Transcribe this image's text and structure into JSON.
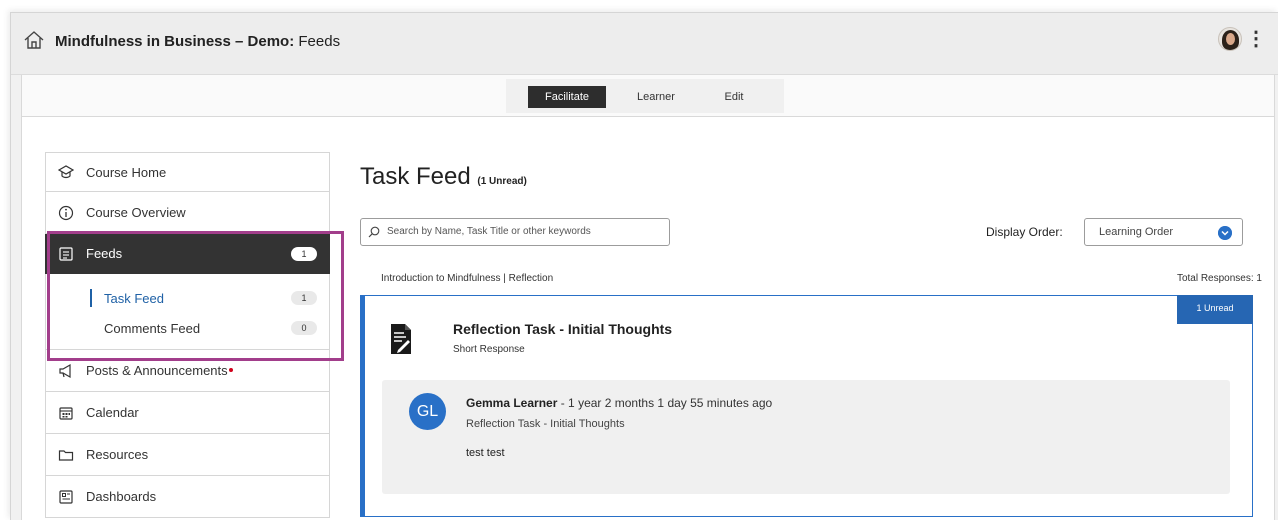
{
  "header": {
    "course_title": "Mindfulness in Business – Demo:",
    "section": "Feeds",
    "icons": {
      "home": "home-icon",
      "avatar": "user-avatar",
      "menu": "kebab-menu-icon"
    }
  },
  "modes": {
    "facilitate": "Facilitate",
    "learner": "Learner",
    "edit": "Edit",
    "active": "Facilitate"
  },
  "sidebar": {
    "items": [
      {
        "label": "Course Home",
        "icon": "graduation-cap-icon"
      },
      {
        "label": "Course Overview",
        "icon": "info-icon"
      },
      {
        "label": "Feeds",
        "icon": "feed-icon",
        "count": "1"
      },
      {
        "label": "Posts & Announcements",
        "icon": "megaphone-icon"
      },
      {
        "label": "Calendar",
        "icon": "calendar-icon"
      },
      {
        "label": "Resources",
        "icon": "folder-icon"
      },
      {
        "label": "Dashboards",
        "icon": "dashboard-icon"
      }
    ],
    "sub_items": [
      {
        "label": "Task Feed",
        "count": "1"
      },
      {
        "label": "Comments Feed",
        "count": "0"
      }
    ]
  },
  "main": {
    "title": "Task Feed",
    "unread_note": "(1 Unread)",
    "search_placeholder": "Search by Name, Task Title or other keywords",
    "display_order_label": "Display Order:",
    "display_order_value": "Learning Order",
    "breadcrumb": "Introduction to Mindfulness | Reflection",
    "total_responses": "Total Responses: 1"
  },
  "card": {
    "unread_badge": "1 Unread",
    "task_title": "Reflection Task - Initial Thoughts",
    "task_type": "Short Response",
    "response": {
      "initials": "GL",
      "author": "Gemma Learner",
      "time": " - 1 year 2 months 1 day 55 minutes ago",
      "task_ref": "Reflection Task - Initial Thoughts",
      "body": "test test"
    }
  },
  "colors": {
    "accent": "#2970c7",
    "highlight": "#a23e8b",
    "sidebar_active": "#333333"
  }
}
